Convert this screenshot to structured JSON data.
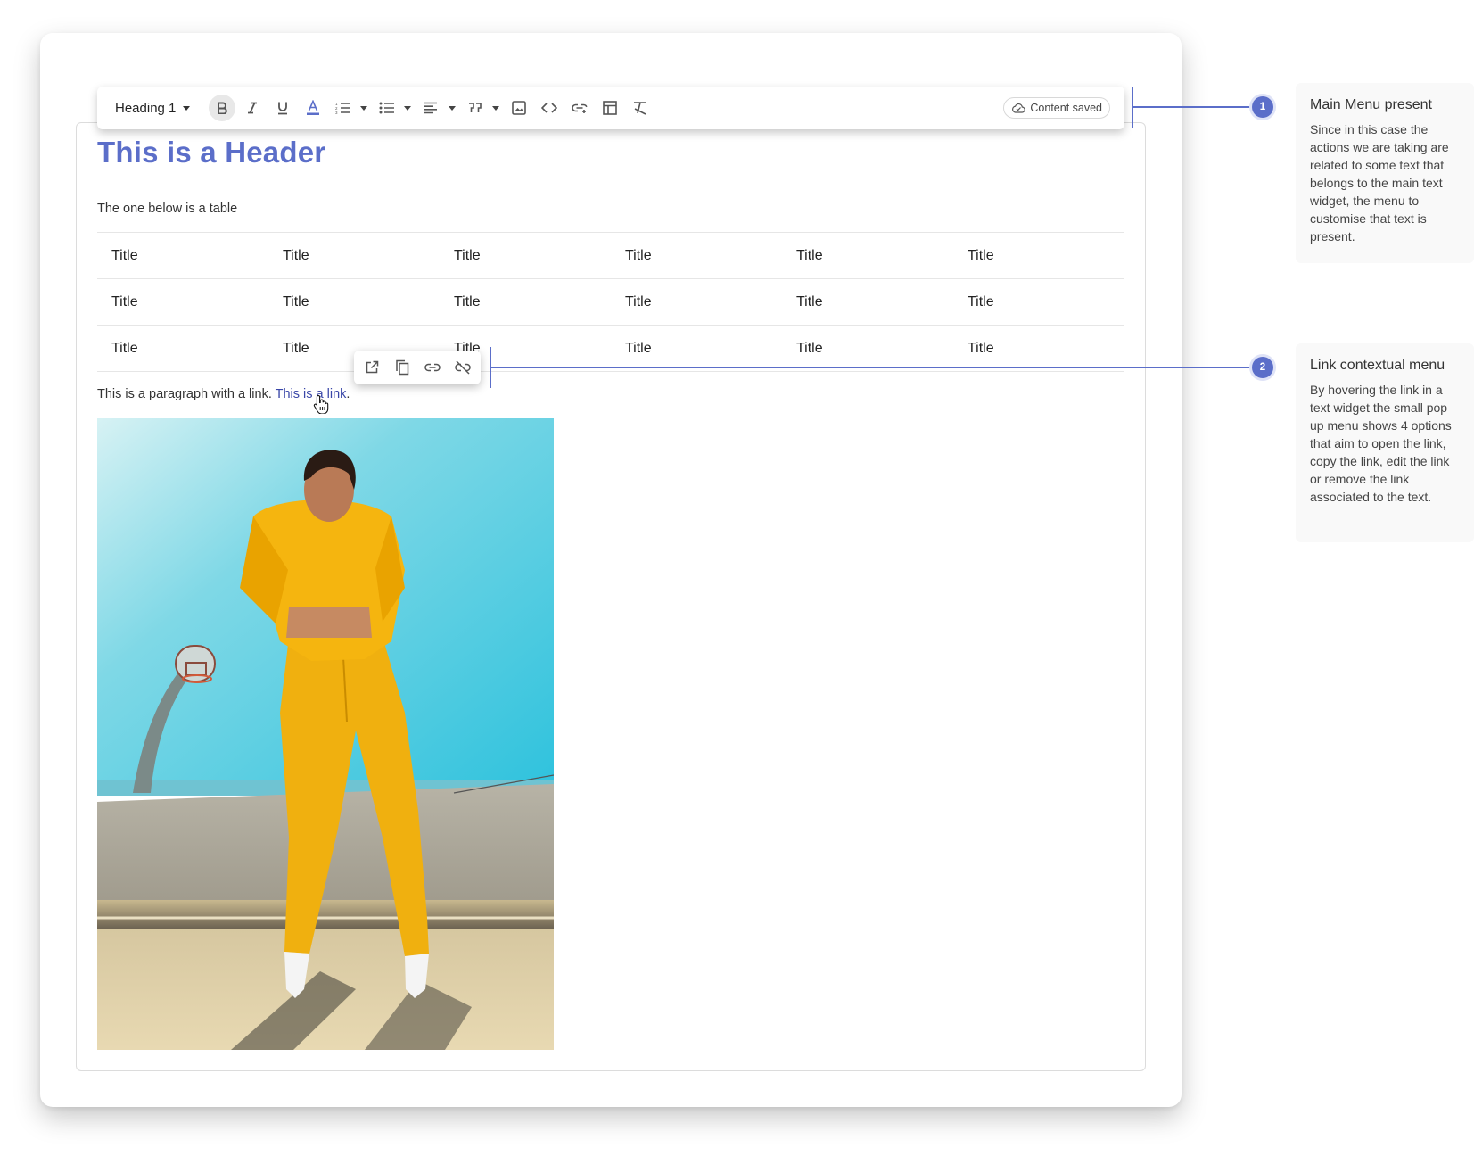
{
  "toolbar": {
    "heading_select": "Heading 1",
    "status": "Content saved"
  },
  "content": {
    "title": "This is a Header",
    "intro": "The one below is a table",
    "table": [
      [
        "Title",
        "Title",
        "Title",
        "Title",
        "Title",
        "Title"
      ],
      [
        "Title",
        "Title",
        "Title",
        "Title",
        "Title",
        "Title"
      ],
      [
        "Title",
        "Title",
        "Title",
        "Title",
        "Title",
        "Title"
      ]
    ],
    "paragraph_prefix": "This is a paragraph with a link. ",
    "link_text": "This is a link",
    "paragraph_suffix": "."
  },
  "link_menu": {
    "icons": [
      "open-external-icon",
      "copy-icon",
      "link-icon",
      "unlink-icon"
    ]
  },
  "annotations": [
    {
      "number": "1",
      "title": "Main Menu present",
      "text": "Since in this case the actions we are taking are related to some text that belongs to the main text widget, the menu to customise that text is present."
    },
    {
      "number": "2",
      "title": "Link contextual menu",
      "text": "By hovering the link in a text widget the small pop up menu shows 4 options that aim to open the link, copy the link, edit the link or remove the link associated to the text."
    }
  ],
  "colors": {
    "accent": "#5b6ec9",
    "link": "#3a47a8"
  }
}
